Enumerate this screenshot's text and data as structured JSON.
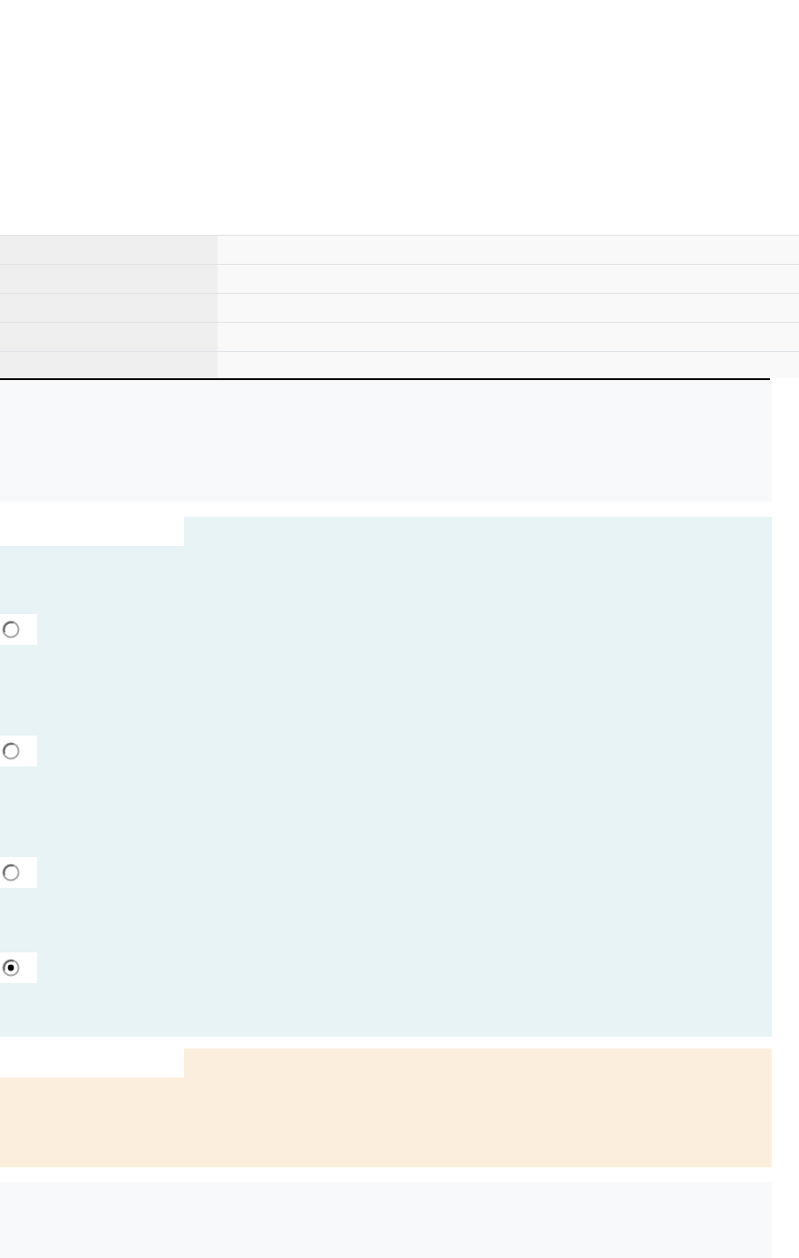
{
  "question": {
    "options": [
      {
        "selected": false
      },
      {
        "selected": false
      },
      {
        "selected": false
      },
      {
        "selected": true
      }
    ]
  }
}
